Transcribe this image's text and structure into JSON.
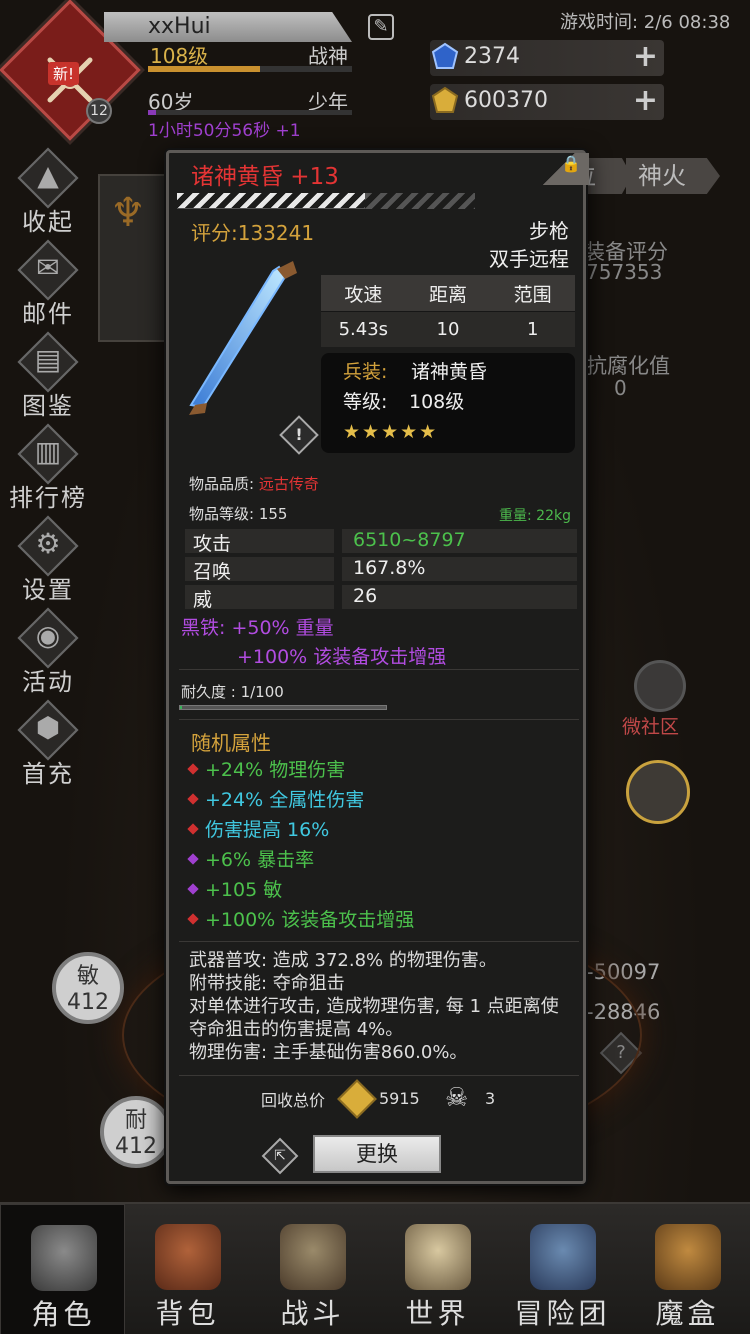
{
  "player": {
    "new_badge": "新!",
    "mini_level": "12",
    "name": "xxHui",
    "level": "108级",
    "rank": "战神",
    "exp_progress": 0.55,
    "age": "60岁",
    "age_stage": "少年",
    "age_progress": 0.04,
    "timer": "1小时50分56秒 +1"
  },
  "header": {
    "game_time": "游戏时间: 2/6 08:38",
    "gems": "2374",
    "gold": "600370"
  },
  "side_menu": [
    {
      "label": "收起",
      "icon": "collapse-icon"
    },
    {
      "label": "邮件",
      "icon": "mail-icon"
    },
    {
      "label": "图鉴",
      "icon": "book-icon"
    },
    {
      "label": "排行榜",
      "icon": "ranking-icon"
    },
    {
      "label": "设置",
      "icon": "gear-icon"
    },
    {
      "label": "活动",
      "icon": "event-icon"
    },
    {
      "label": "首充",
      "icon": "first-charge-icon"
    }
  ],
  "background": {
    "tab1": "位",
    "tab2": "神火",
    "equip_score_label": "装备评分",
    "equip_score_value": "757353",
    "anti_label": "抗腐化值",
    "anti_value": "0",
    "community": "微社区",
    "stat_right_1": "-50097",
    "stat_right_2": "-28846",
    "help": "?",
    "agility_label": "敏",
    "agility_value": "412",
    "stamina_label": "耐",
    "stamina_value": "412"
  },
  "item": {
    "title": "诸神黄昏 +13",
    "lock": "🔒",
    "score": "评分:133241",
    "weapon_type": "步枪",
    "weapon_hand": "双手远程",
    "stats_head": [
      "攻速",
      "距离",
      "范围"
    ],
    "stats_values": [
      "5.43s",
      "10",
      "1"
    ],
    "set_label": "兵装:",
    "set_name": "诸神黄昏",
    "set_level_label": "等级:",
    "set_level": "108级",
    "stars": "★★★★★",
    "warn": "!",
    "quality_label": "物品品质: ",
    "quality_value": "远古传奇",
    "item_level": "物品等级: 155",
    "weight": "重量: 22kg",
    "attrs": [
      {
        "name": "攻击",
        "value": "6510~8797",
        "color": "#4cc14c"
      },
      {
        "name": "召唤",
        "value": "167.8%",
        "color": "#eeeeee"
      },
      {
        "name": "威",
        "value": "26",
        "color": "#eeeeee"
      }
    ],
    "purple_1": "黑铁: +50% 重量",
    "purple_2": "+100% 该装备攻击增强",
    "durability": "耐久度 : 1/100",
    "durability_progress": 0.01,
    "random_title": "随机属性",
    "random_attrs": [
      {
        "text": "+24% 物理伤害",
        "color": "#4cc14c",
        "dot": "#d03030"
      },
      {
        "text": "+24% 全属性伤害",
        "color": "#40c8e0",
        "dot": "#d03030"
      },
      {
        "text": "伤害提高 16%",
        "color": "#40c8e0",
        "dot": "#d03030"
      },
      {
        "text": "+6% 暴击率",
        "color": "#4cc14c",
        "dot": "#a040d0"
      },
      {
        "text": "+105 敏",
        "color": "#4cc14c",
        "dot": "#a040d0"
      },
      {
        "text": "+100% 该装备攻击增强",
        "color": "#4cc14c",
        "dot": "#d03030"
      }
    ],
    "desc_1": "武器普攻: 造成 372.8% 的物理伤害。",
    "desc_2": "附带技能: 夺命狙击",
    "desc_3": "对单体进行攻击, 造成物理伤害, 每 1 点距离使夺命狙击的伤害提高 4%。",
    "desc_4": "物理伤害: 主手基础伤害860.0%。",
    "recycle_label": "回收总价",
    "recycle_gold": "5915",
    "recycle_skull": "3",
    "swap_button": "更换"
  },
  "bottom_nav": [
    {
      "label": "角色",
      "icon": "character-icon",
      "active": true
    },
    {
      "label": "背包",
      "icon": "backpack-icon",
      "active": false
    },
    {
      "label": "战斗",
      "icon": "battle-icon",
      "active": false
    },
    {
      "label": "世界",
      "icon": "world-icon",
      "active": false
    },
    {
      "label": "冒险团",
      "icon": "guild-icon",
      "active": false
    },
    {
      "label": "魔盒",
      "icon": "magic-box-icon",
      "active": false
    }
  ],
  "colors": {
    "accent_red": "#e33434",
    "gold": "#d3a23c",
    "green": "#4cc14c",
    "purple": "#b14ce0",
    "cyan": "#40c8e0"
  }
}
